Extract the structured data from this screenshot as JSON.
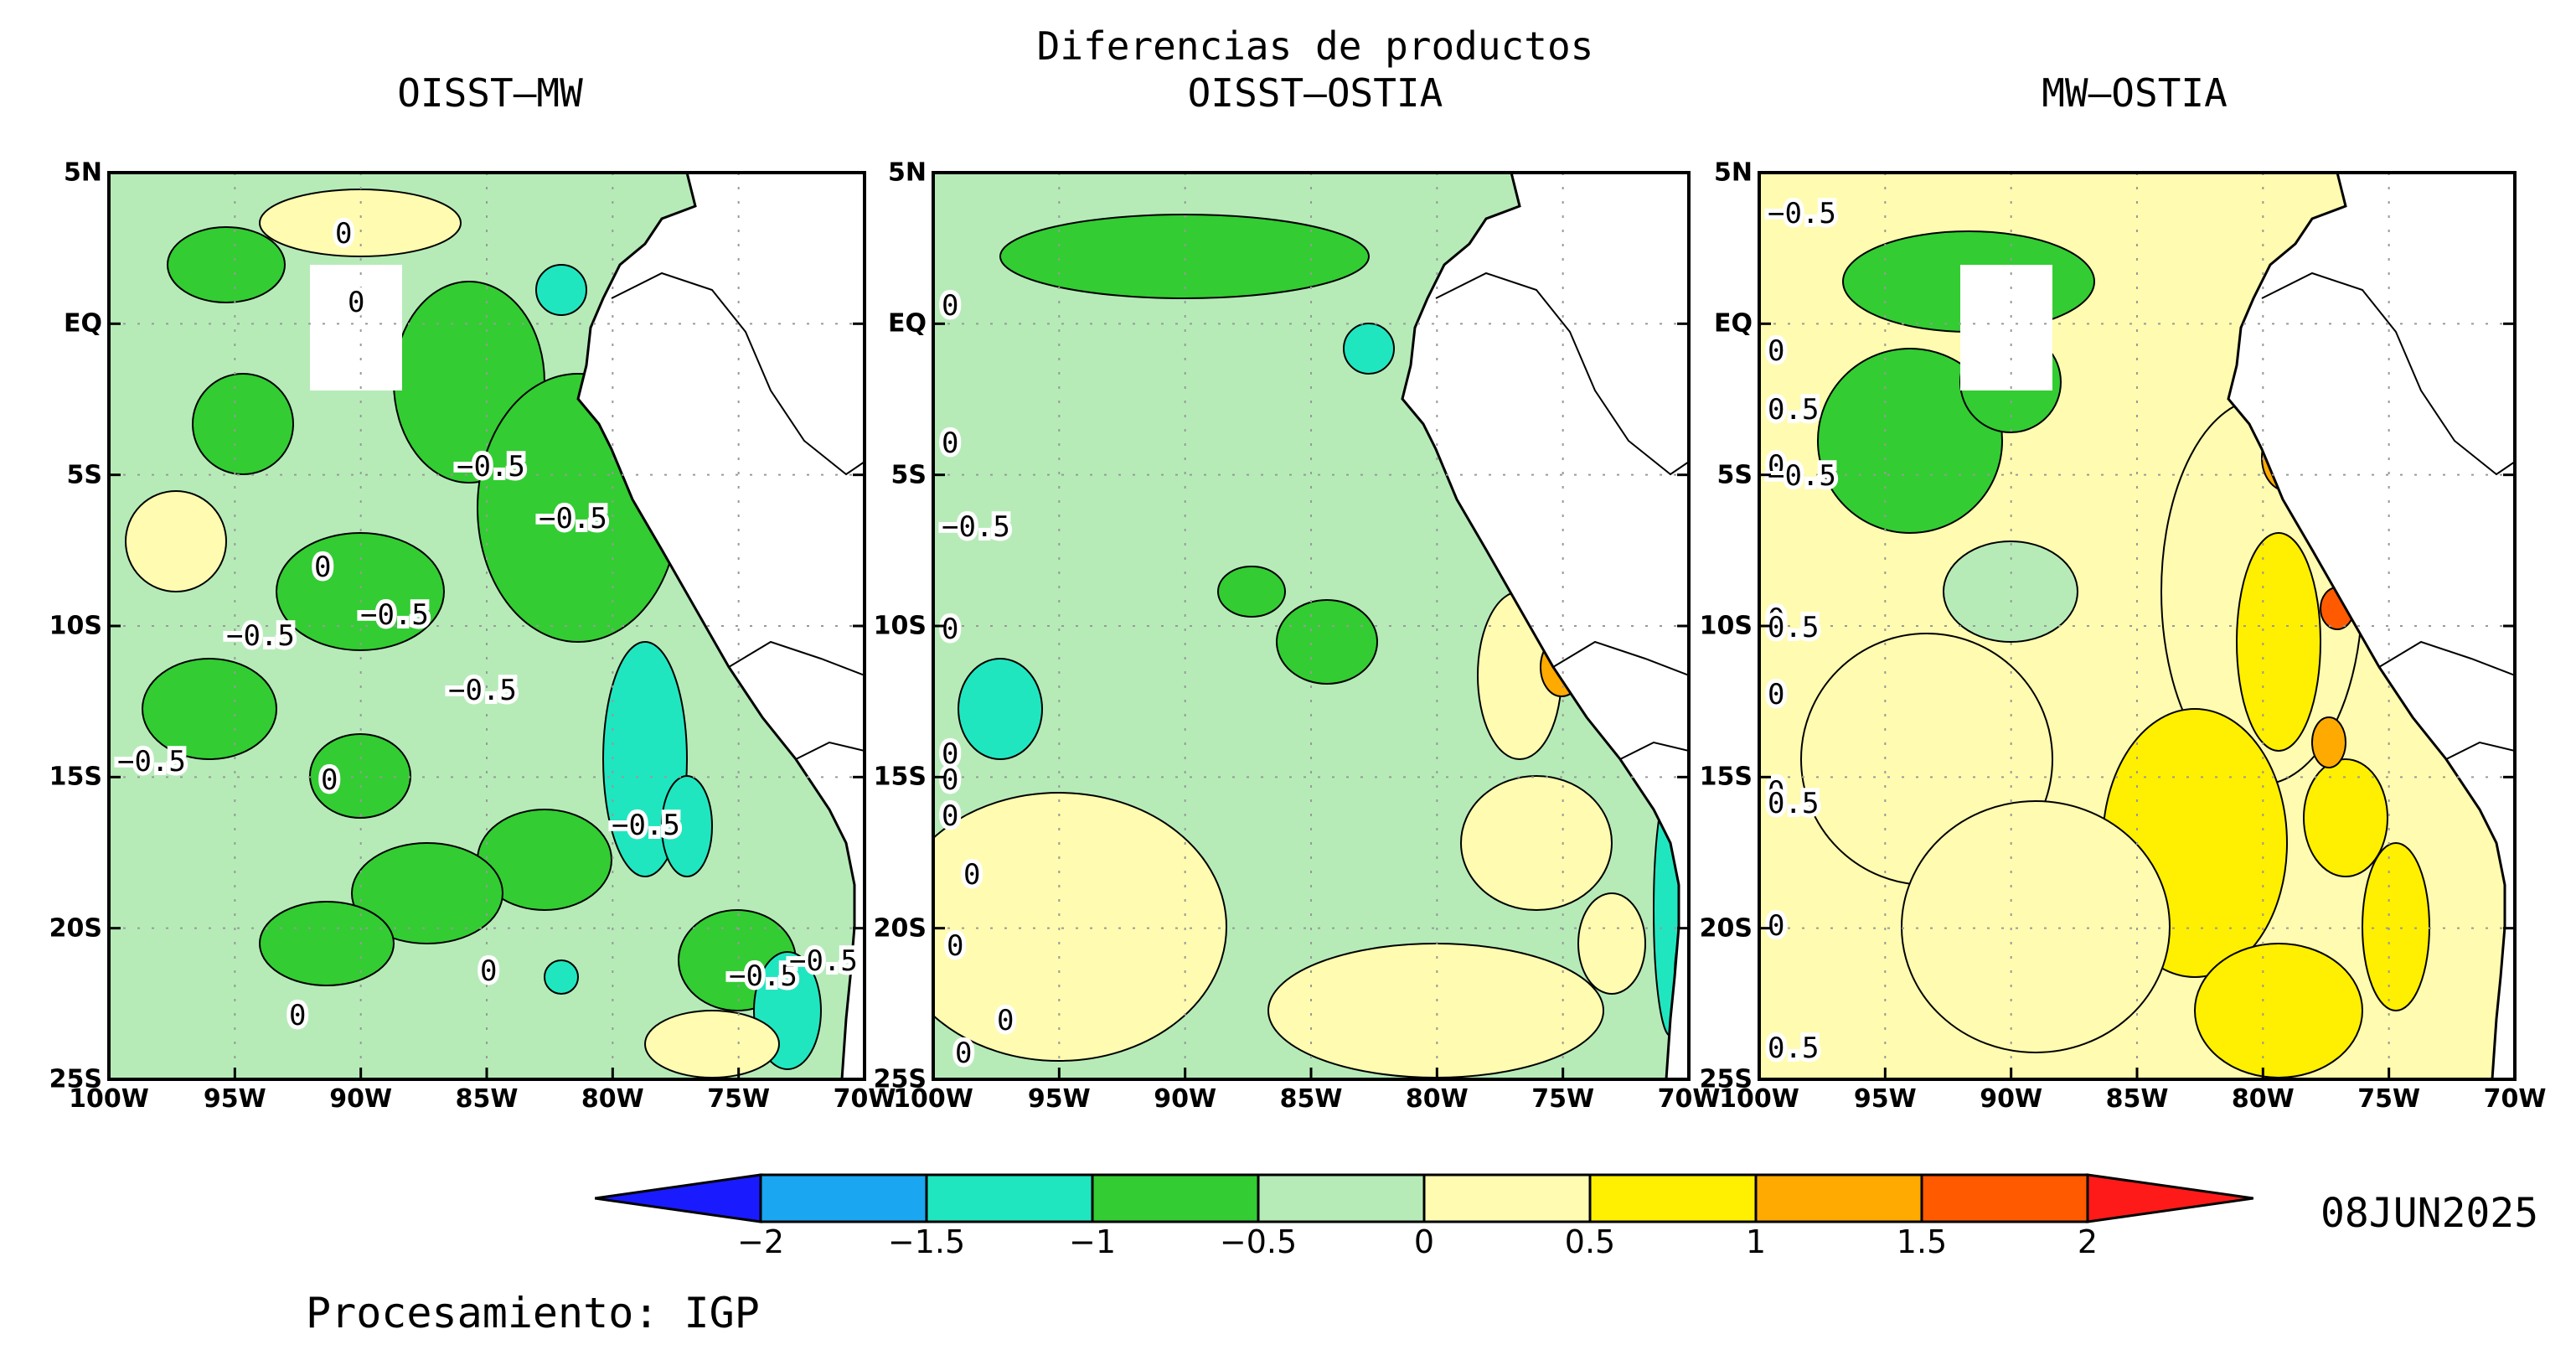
{
  "figure_title": "Diferencias de productos",
  "date": "08JUN2025",
  "credit": "Procesamiento: IGP",
  "lat_labels": [
    "5N",
    "EQ",
    "5S",
    "10S",
    "15S",
    "20S",
    "25S"
  ],
  "lon_labels": [
    "100W",
    "95W",
    "90W",
    "85W",
    "80W",
    "75W",
    "70W"
  ],
  "panels": [
    {
      "title": "OISST–MW",
      "contour_labels": [
        "0",
        "0",
        "−0.5",
        "−0.5",
        "0",
        "−0.5",
        "−0.5",
        "−0.5",
        "−0.5",
        "0",
        "−0.5",
        "0",
        "0",
        "−0.5",
        "−0.5"
      ]
    },
    {
      "title": "OISST–OSTIA",
      "contour_labels": [
        "0",
        "0",
        "−0.5",
        "0",
        "0",
        "0",
        "0",
        "0",
        "0",
        "0",
        "0"
      ]
    },
    {
      "title": "MW–OSTIA",
      "contour_labels": [
        "−0.5",
        "0",
        "0.5",
        "0",
        "−0.5",
        "0",
        "0.5",
        "0",
        "0",
        "0",
        "0.5",
        "0",
        "0.5"
      ]
    }
  ],
  "colorbar": {
    "ticks": [
      "−2",
      "−1.5",
      "−1",
      "−0.5",
      "0",
      "0.5",
      "1",
      "1.5",
      "2"
    ],
    "colors": [
      "#1a1aff",
      "#1aa6f0",
      "#20e6c0",
      "#33cc33",
      "#b6ebb8",
      "#fffbb0",
      "#ffef00",
      "#ffaa00",
      "#ff5a00",
      "#ff1a1a"
    ]
  }
}
